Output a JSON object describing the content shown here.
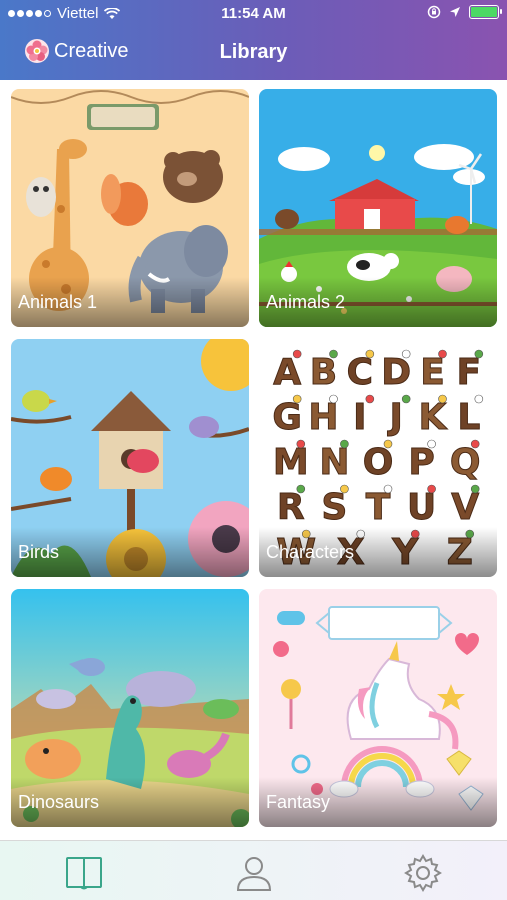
{
  "status_bar": {
    "carrier": "Viettel",
    "time": "11:54 AM"
  },
  "nav": {
    "back_label": "Creative",
    "title": "Library"
  },
  "library": [
    {
      "label": "Animals 1"
    },
    {
      "label": "Animals 2"
    },
    {
      "label": "Birds"
    },
    {
      "label": "Characters"
    },
    {
      "label": "Dinosaurs"
    },
    {
      "label": "Fantasy"
    }
  ],
  "characters_art_letters": [
    "A",
    "B",
    "C",
    "D",
    "E",
    "F",
    "G",
    "H",
    "I",
    "J",
    "K",
    "L",
    "M",
    "N",
    "O",
    "P",
    "Q",
    "R",
    "S",
    "T",
    "U",
    "V",
    "W",
    "X",
    "Y",
    "Z"
  ],
  "fantasy_banner_text": "",
  "tabs": [
    {
      "icon": "book-icon",
      "selected": true
    },
    {
      "icon": "person-icon",
      "selected": false
    },
    {
      "icon": "gear-icon",
      "selected": false
    }
  ],
  "colors": {
    "nav_gradient_start": "#4a78c9",
    "nav_gradient_end": "#8a53b0",
    "tab_active": "#3aa68a",
    "tab_inactive": "#8a8a8a"
  }
}
